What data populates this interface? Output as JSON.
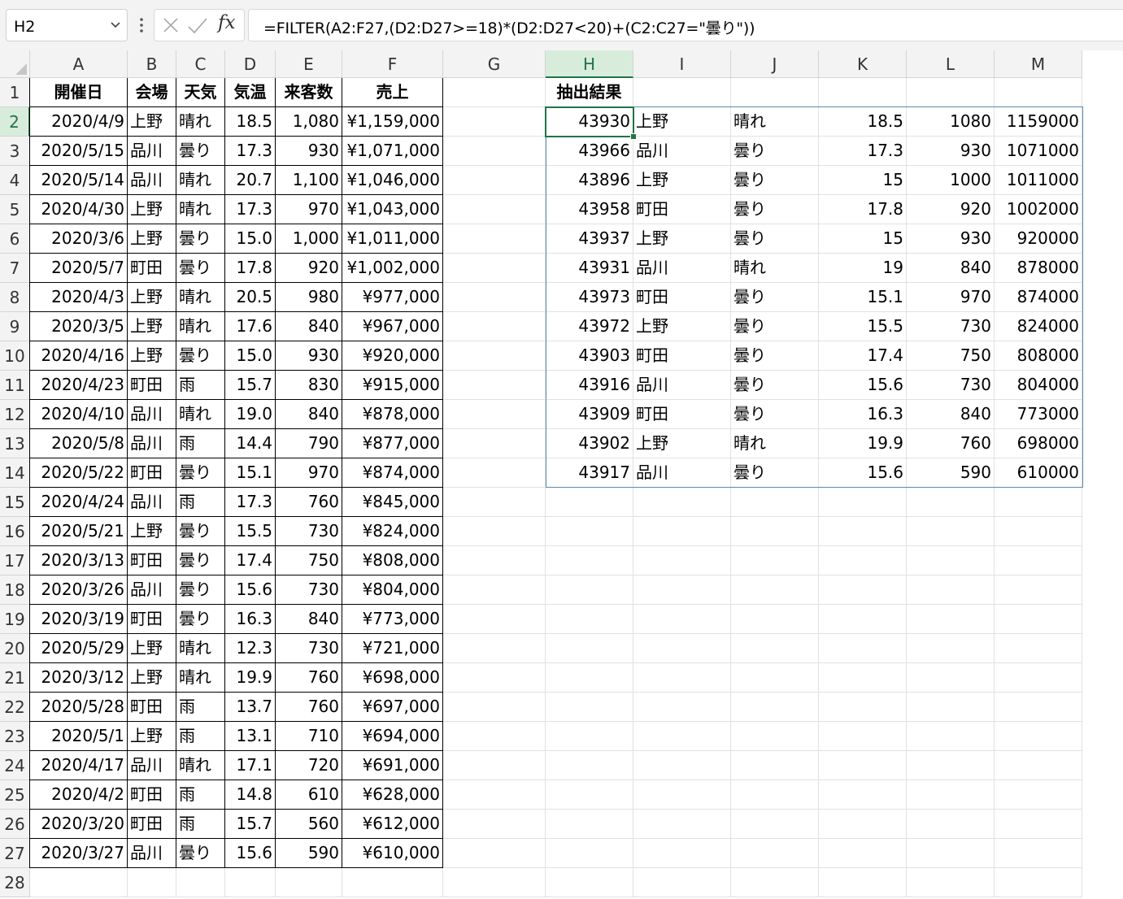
{
  "formula_bar": {
    "name_box": "H2",
    "formula": "=FILTER(A2:F27,(D2:D27>=18)*(D2:D27<20)+(C2:C27=\"曇り\"))",
    "fx_label": "fx"
  },
  "columns": [
    "A",
    "B",
    "C",
    "D",
    "E",
    "F",
    "G",
    "H",
    "I",
    "J",
    "K",
    "L",
    "M"
  ],
  "active_column": "H",
  "active_row": "2",
  "rows": [
    "1",
    "2",
    "3",
    "4",
    "5",
    "6",
    "7",
    "8",
    "9",
    "10",
    "11",
    "12",
    "13",
    "14",
    "15",
    "16",
    "17",
    "18",
    "19",
    "20",
    "21",
    "22",
    "23",
    "24",
    "25",
    "26",
    "27",
    "28"
  ],
  "source_table": {
    "headers": [
      "開催日",
      "会場",
      "天気",
      "気温",
      "来客数",
      "売上"
    ],
    "rows": [
      [
        "2020/4/9",
        "上野",
        "晴れ",
        "18.5",
        "1,080",
        "¥1,159,000"
      ],
      [
        "2020/5/15",
        "品川",
        "曇り",
        "17.3",
        "930",
        "¥1,071,000"
      ],
      [
        "2020/5/14",
        "品川",
        "晴れ",
        "20.7",
        "1,100",
        "¥1,046,000"
      ],
      [
        "2020/4/30",
        "上野",
        "晴れ",
        "17.3",
        "970",
        "¥1,043,000"
      ],
      [
        "2020/3/6",
        "上野",
        "曇り",
        "15.0",
        "1,000",
        "¥1,011,000"
      ],
      [
        "2020/5/7",
        "町田",
        "曇り",
        "17.8",
        "920",
        "¥1,002,000"
      ],
      [
        "2020/4/3",
        "上野",
        "晴れ",
        "20.5",
        "980",
        "¥977,000"
      ],
      [
        "2020/3/5",
        "上野",
        "晴れ",
        "17.6",
        "840",
        "¥967,000"
      ],
      [
        "2020/4/16",
        "上野",
        "曇り",
        "15.0",
        "930",
        "¥920,000"
      ],
      [
        "2020/4/23",
        "町田",
        "雨",
        "15.7",
        "830",
        "¥915,000"
      ],
      [
        "2020/4/10",
        "品川",
        "晴れ",
        "19.0",
        "840",
        "¥878,000"
      ],
      [
        "2020/5/8",
        "品川",
        "雨",
        "14.4",
        "790",
        "¥877,000"
      ],
      [
        "2020/5/22",
        "町田",
        "曇り",
        "15.1",
        "970",
        "¥874,000"
      ],
      [
        "2020/4/24",
        "品川",
        "雨",
        "17.3",
        "760",
        "¥845,000"
      ],
      [
        "2020/5/21",
        "上野",
        "曇り",
        "15.5",
        "730",
        "¥824,000"
      ],
      [
        "2020/3/13",
        "町田",
        "曇り",
        "17.4",
        "750",
        "¥808,000"
      ],
      [
        "2020/3/26",
        "品川",
        "曇り",
        "15.6",
        "730",
        "¥804,000"
      ],
      [
        "2020/3/19",
        "町田",
        "曇り",
        "16.3",
        "840",
        "¥773,000"
      ],
      [
        "2020/5/29",
        "上野",
        "晴れ",
        "12.3",
        "730",
        "¥721,000"
      ],
      [
        "2020/3/12",
        "上野",
        "晴れ",
        "19.9",
        "760",
        "¥698,000"
      ],
      [
        "2020/5/28",
        "町田",
        "雨",
        "13.7",
        "760",
        "¥697,000"
      ],
      [
        "2020/5/1",
        "上野",
        "雨",
        "13.1",
        "710",
        "¥694,000"
      ],
      [
        "2020/4/17",
        "品川",
        "晴れ",
        "17.1",
        "720",
        "¥691,000"
      ],
      [
        "2020/4/2",
        "町田",
        "雨",
        "14.8",
        "610",
        "¥628,000"
      ],
      [
        "2020/3/20",
        "町田",
        "雨",
        "15.7",
        "560",
        "¥612,000"
      ],
      [
        "2020/3/27",
        "品川",
        "曇り",
        "15.6",
        "590",
        "¥610,000"
      ]
    ]
  },
  "result_table": {
    "header": "抽出結果",
    "rows": [
      [
        "43930",
        "上野",
        "晴れ",
        "18.5",
        "1080",
        "1159000"
      ],
      [
        "43966",
        "品川",
        "曇り",
        "17.3",
        "930",
        "1071000"
      ],
      [
        "43896",
        "上野",
        "曇り",
        "15",
        "1000",
        "1011000"
      ],
      [
        "43958",
        "町田",
        "曇り",
        "17.8",
        "920",
        "1002000"
      ],
      [
        "43937",
        "上野",
        "曇り",
        "15",
        "930",
        "920000"
      ],
      [
        "43931",
        "品川",
        "晴れ",
        "19",
        "840",
        "878000"
      ],
      [
        "43973",
        "町田",
        "曇り",
        "15.1",
        "970",
        "874000"
      ],
      [
        "43972",
        "上野",
        "曇り",
        "15.5",
        "730",
        "824000"
      ],
      [
        "43903",
        "町田",
        "曇り",
        "17.4",
        "750",
        "808000"
      ],
      [
        "43916",
        "品川",
        "曇り",
        "15.6",
        "730",
        "804000"
      ],
      [
        "43909",
        "町田",
        "曇り",
        "16.3",
        "840",
        "773000"
      ],
      [
        "43902",
        "上野",
        "晴れ",
        "19.9",
        "760",
        "698000"
      ],
      [
        "43917",
        "品川",
        "曇り",
        "15.6",
        "590",
        "610000"
      ]
    ]
  }
}
